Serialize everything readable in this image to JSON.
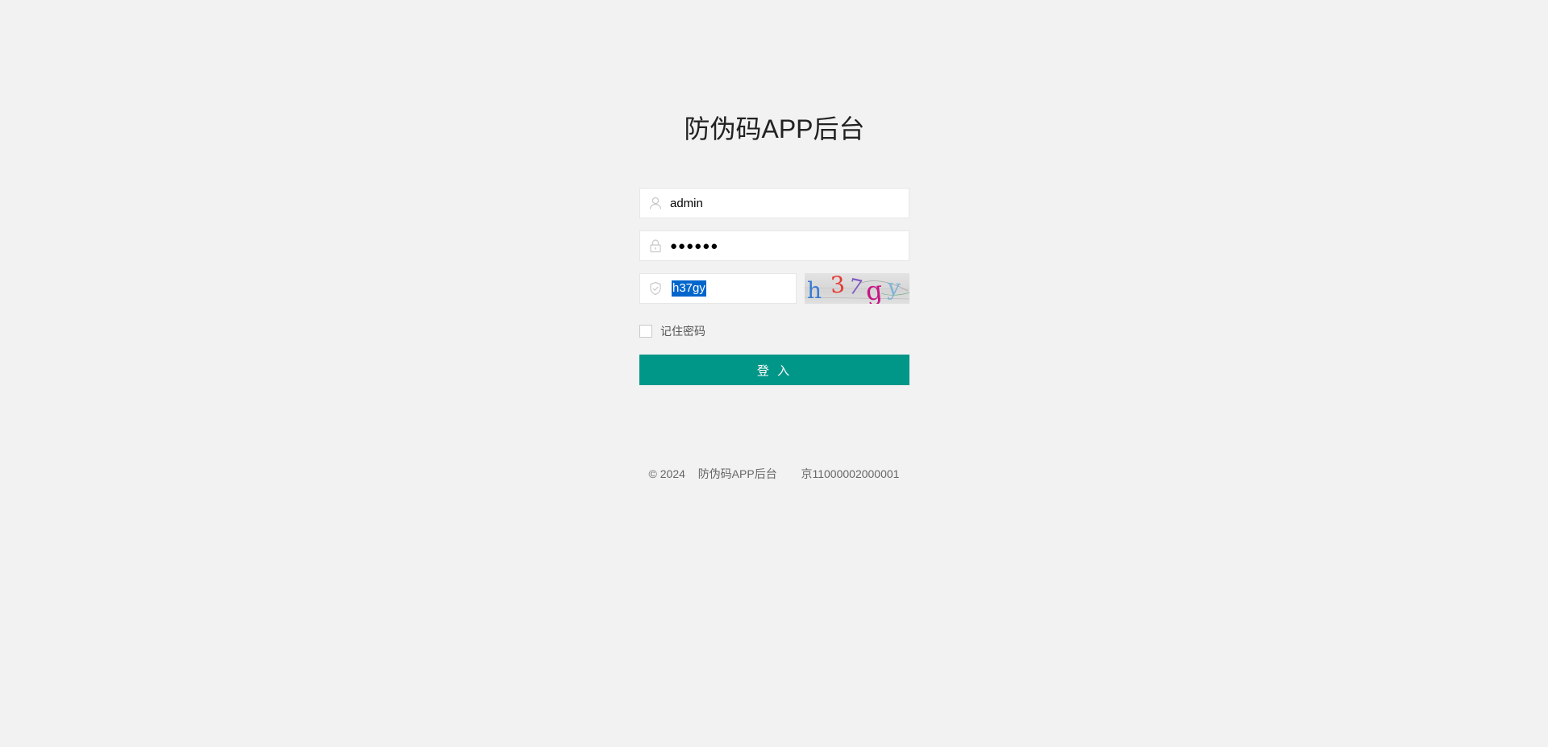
{
  "page": {
    "title": "防伪码APP后台"
  },
  "form": {
    "username": {
      "value": "admin",
      "icon": "user-icon"
    },
    "password": {
      "value": "●●●●●●",
      "icon": "lock-icon"
    },
    "captcha": {
      "value": "h37gy",
      "icon": "shield-icon",
      "image_text": [
        "h",
        "3",
        "7",
        "g",
        "y"
      ],
      "image_colors": [
        "#3a7bd5",
        "#e53935",
        "#7e57c2",
        "#c71585",
        "#7fb3d5"
      ]
    },
    "remember": {
      "label": "记住密码",
      "checked": false
    },
    "submit_label": "登 入"
  },
  "footer": {
    "copyright": "© 2024",
    "site_name": "防伪码APP后台",
    "icp": "京11000002000001"
  },
  "colors": {
    "background": "#f2f2f2",
    "accent": "#009688",
    "selection": "#0066cc"
  }
}
